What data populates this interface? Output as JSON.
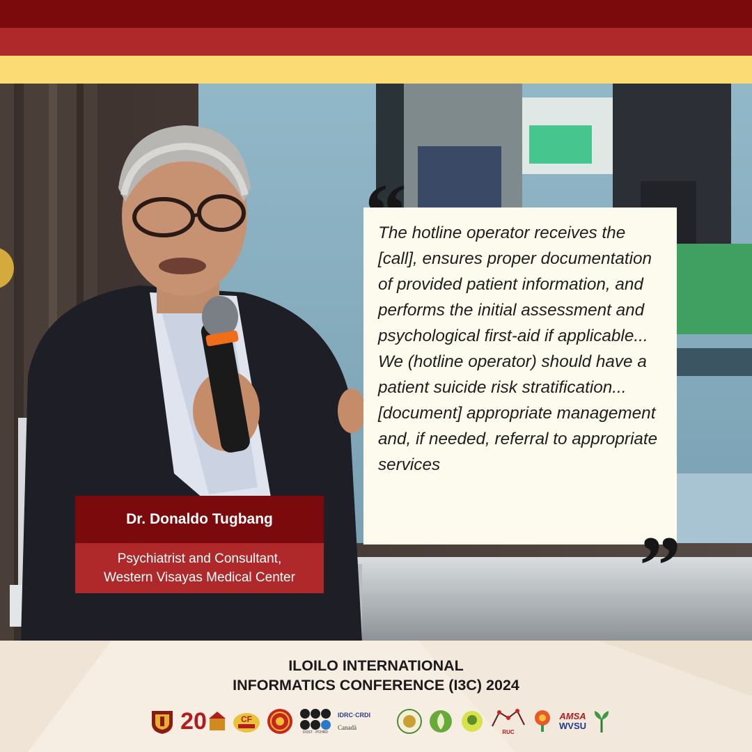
{
  "quote": {
    "text": "The hotline operator receives the [call], ensures proper documentation of provided patient information, and performs the initial assessment and psychological first-aid if applicable... We (hotline operator) should have a patient suicide risk stratification...[document] appropriate management and, if needed, referral to appropriate services",
    "open_mark": "“",
    "close_mark": "”"
  },
  "speaker": {
    "name": "Dr. Donaldo Tugbang",
    "title_line1": "Psychiatrist and Consultant,",
    "title_line2": "Western Visayas Medical Center"
  },
  "footer": {
    "title_line1": "ILOILO INTERNATIONAL",
    "title_line2": "INFORMATICS CONFERENCE (I3C) 2024"
  },
  "logos": {
    "twentieth_years": "20",
    "dost_label": "DOST · PCHRD",
    "idrc": "IDRC·CRDI",
    "canada": "Canadä",
    "ruc": "RUC",
    "amsa": "AMSA",
    "wvsu": "WVSU"
  },
  "colors": {
    "dark_red": "#7a0a0c",
    "red": "#b0292a",
    "yellow": "#fbdc74",
    "cream": "#fdfbed",
    "footer_bg": "#f6eee2"
  }
}
